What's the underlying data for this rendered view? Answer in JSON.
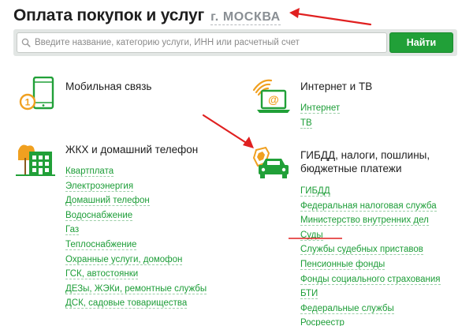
{
  "header": {
    "title": "Оплата покупок и услуг",
    "city": "г. МОСКВА"
  },
  "search": {
    "placeholder": "Введите название, категорию услуги, ИНН или расчетный счет",
    "button_label": "Найти"
  },
  "colors": {
    "accent": "#21a038",
    "link": "#1c9d37",
    "icon_orange": "#f0a020",
    "arrow": "#e02020"
  },
  "categories": {
    "mobile": {
      "title": "Мобильная связь",
      "icon": "mobile-phone-icon",
      "links": []
    },
    "internet": {
      "title": "Интернет и ТВ",
      "icon": "laptop-wifi-icon",
      "links": [
        "Интернет",
        "ТВ"
      ]
    },
    "housing": {
      "title": "ЖКХ и домашний телефон",
      "icon": "building-icon",
      "links": [
        "Квартплата",
        "Электроэнергия",
        "Домашний телефон",
        "Водоснабжение",
        "Газ",
        "Теплоснабжение",
        "Охранные услуги, домофон",
        "ГСК, автостоянки",
        "ДЕЗы, ЖЭКи, ремонтные службы",
        "ДСК, садовые товарищества"
      ]
    },
    "gibdd": {
      "title_line1": "ГИБДД, налоги, пошлины,",
      "title_line2": "бюджетные платежи",
      "icon": "car-emblem-icon",
      "links": [
        "ГИБДД",
        "Федеральная налоговая служба",
        "Министерство внутренних дел",
        "Суды",
        "Службы судебных приставов",
        "Пенсионные фонды",
        "Фонды социального страхования",
        "БТИ",
        "Федеральные службы",
        "Росреестр"
      ]
    }
  }
}
